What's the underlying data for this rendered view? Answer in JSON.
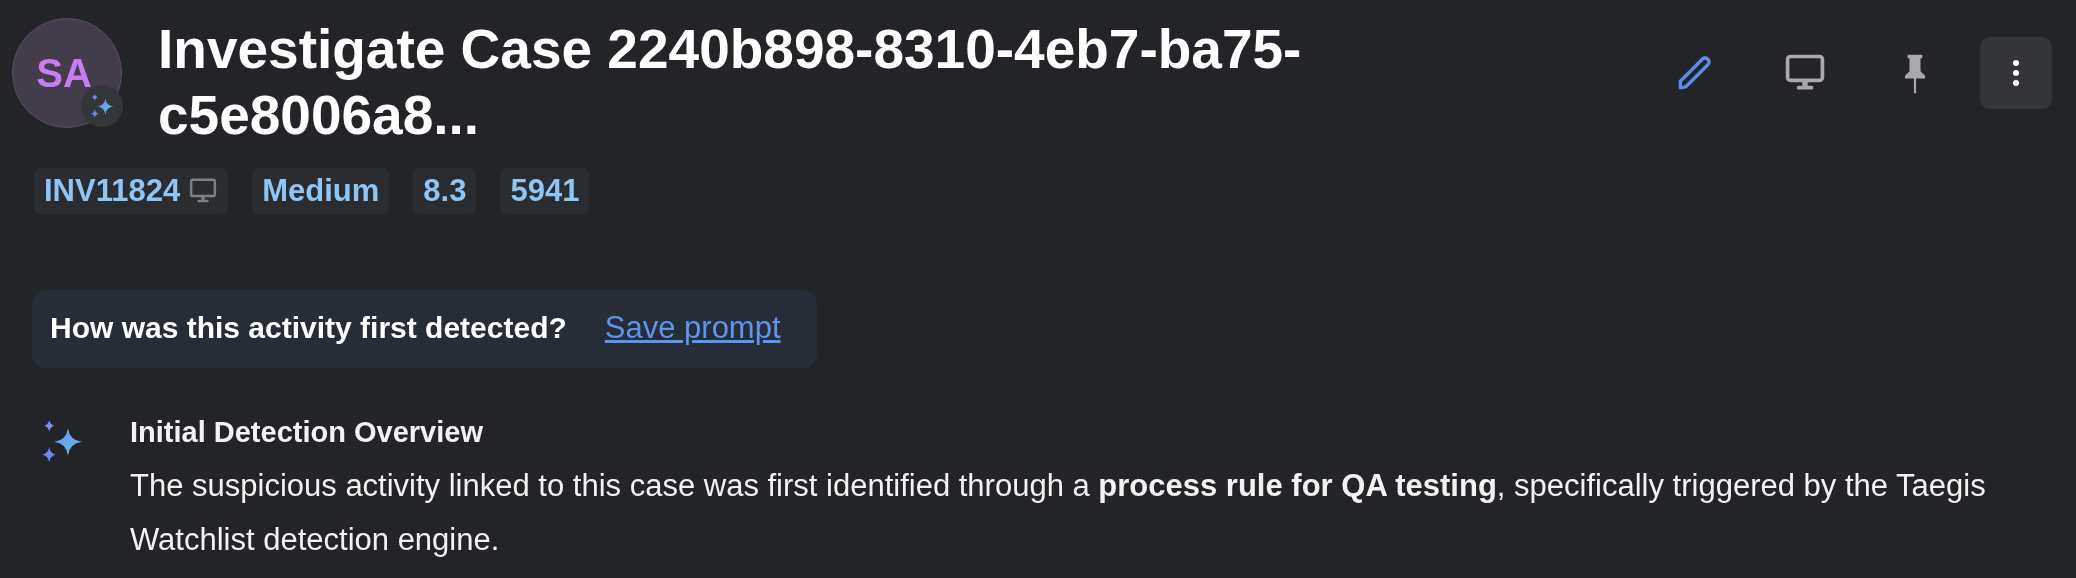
{
  "header": {
    "avatar": {
      "initials": "SA",
      "ai_badge": true
    },
    "title": "Investigate Case 2240b898-8310-4eb7-ba75-c5e8006a8...",
    "actions": [
      {
        "kind": "edit"
      },
      {
        "kind": "monitor"
      },
      {
        "kind": "pin"
      },
      {
        "kind": "more"
      }
    ]
  },
  "tags": [
    {
      "label": "INV11824",
      "monitor_icon": true
    },
    {
      "label": "Medium",
      "monitor_icon": false
    },
    {
      "label": "8.3",
      "monitor_icon": false
    },
    {
      "label": "5941",
      "monitor_icon": false
    }
  ],
  "prompt": {
    "question": "How was this activity first detected?",
    "link": "Save prompt"
  },
  "response": {
    "heading": "Initial Detection Overview",
    "text": "The suspicious activity linked to this case was first identified through a **process rule for QA testing**, specifically triggered by the Taegis Watchlist detection engine."
  }
}
